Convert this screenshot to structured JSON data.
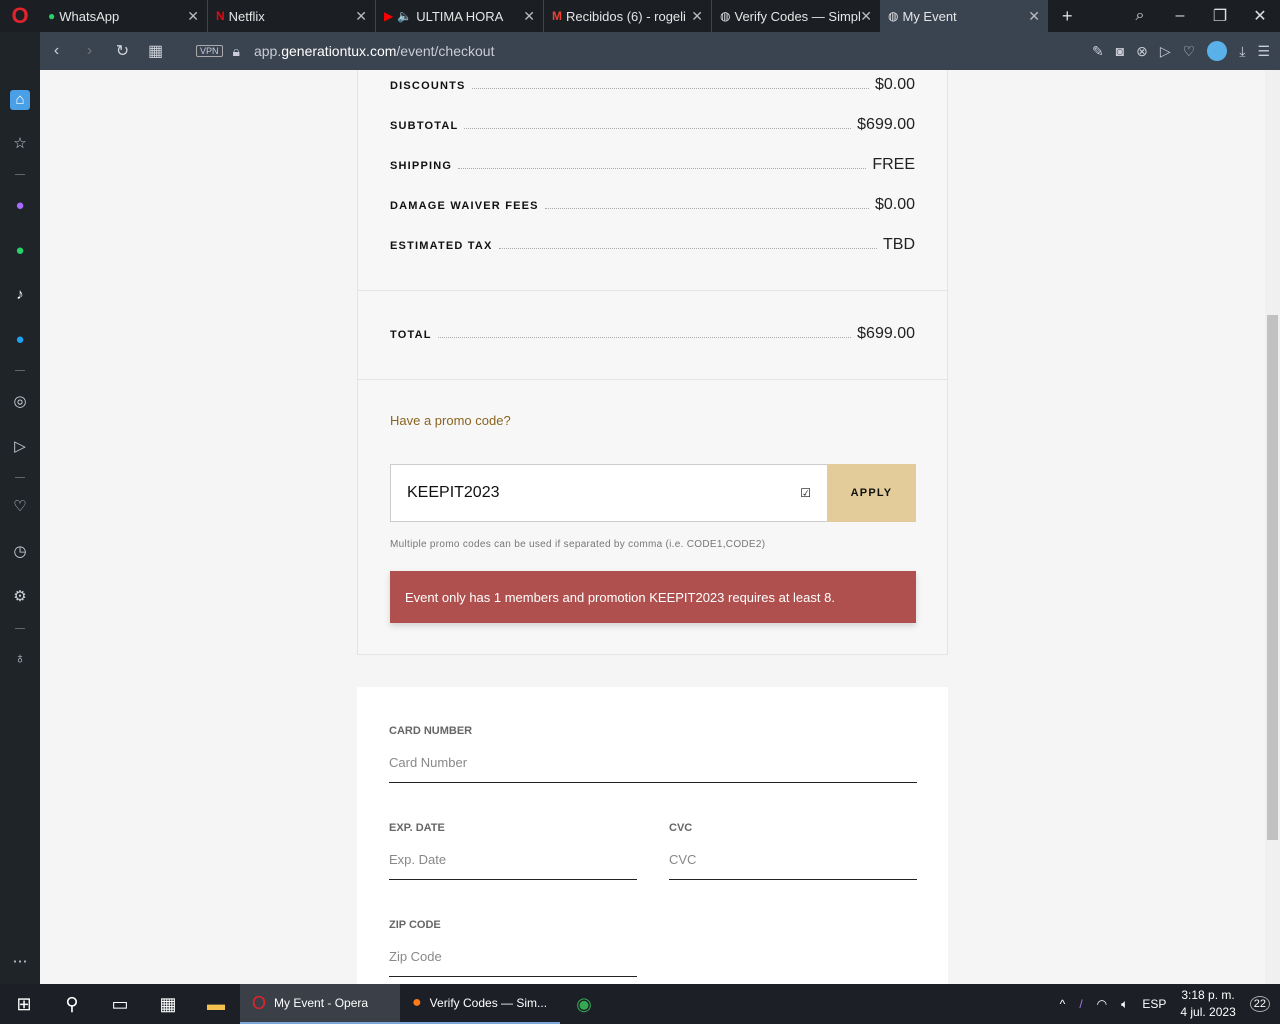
{
  "browser": {
    "tabs": [
      {
        "title": "WhatsApp",
        "icon": "whatsapp-icon"
      },
      {
        "title": "Netflix",
        "icon": "netflix-icon"
      },
      {
        "title": "ULTIMA HORA",
        "icon": "youtube-icon"
      },
      {
        "title": "Recibidos (6) - rogelio",
        "icon": "gmail-icon"
      },
      {
        "title": "Verify Codes — Simpl",
        "icon": "globe-icon"
      },
      {
        "title": "My Event",
        "icon": "globe-icon",
        "active": true
      }
    ],
    "url_prefix": "app.",
    "url_domain": "generationtux.com",
    "url_path": "/event/checkout",
    "vpn": "VPN"
  },
  "summary": {
    "rows": [
      {
        "label": "DISCOUNTS",
        "value": "$0.00"
      },
      {
        "label": "SUBTOTAL",
        "value": "$699.00"
      },
      {
        "label": "SHIPPING",
        "value": "FREE"
      },
      {
        "label": "DAMAGE WAIVER FEES",
        "value": "$0.00"
      },
      {
        "label": "ESTIMATED TAX",
        "value": "TBD"
      }
    ],
    "total": {
      "label": "TOTAL",
      "value": "$699.00"
    }
  },
  "promo": {
    "link": "Have a promo code?",
    "value": "KEEPIT2023",
    "apply": "APPLY",
    "hint": "Multiple promo codes can be used if separated by comma (i.e. CODE1,CODE2)",
    "error": "Event only has 1 members and promotion KEEPIT2023 requires at least 8.",
    "error_color": "#b0504e"
  },
  "payment": {
    "card_label": "CARD NUMBER",
    "card_ph": "Card Number",
    "exp_label": "EXP. DATE",
    "exp_ph": "Exp. Date",
    "cvc_label": "CVC",
    "cvc_ph": "CVC",
    "zip_label": "ZIP CODE",
    "zip_ph": "Zip Code"
  },
  "taskbar": {
    "apps": [
      {
        "label": "My Event - Opera"
      },
      {
        "label": "Verify Codes — Sim..."
      }
    ],
    "lang": "ESP",
    "time": "3:18 p. m.",
    "date": "4 jul. 2023",
    "notifications": "22"
  }
}
